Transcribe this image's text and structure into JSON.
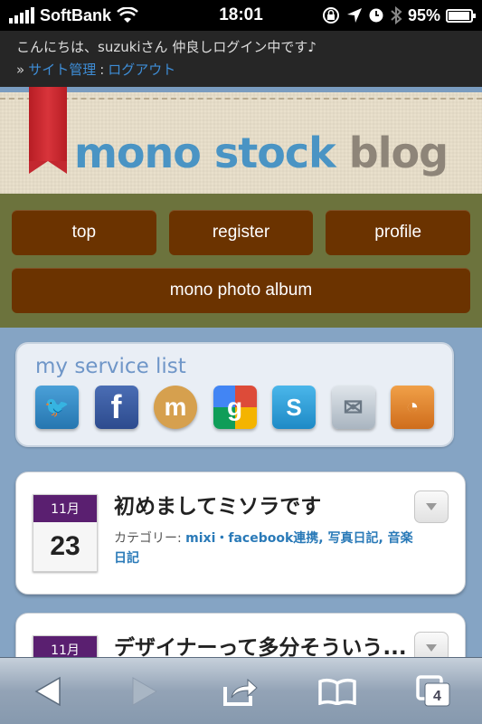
{
  "status_bar": {
    "carrier": "SoftBank",
    "time": "18:01",
    "battery_percent": "95%",
    "battery_level": 0.95
  },
  "admin_bar": {
    "greeting": "こんにちは、suzukiさん 仲良しログイン中です♪",
    "raquo": "»",
    "site_admin_link": "サイト管理",
    "separator": ":",
    "logout_link": "ログアウト"
  },
  "header": {
    "title_part1": "mono",
    "title_part2": "stock",
    "title_part3": "blog"
  },
  "nav": {
    "items": [
      {
        "label": "top"
      },
      {
        "label": "register"
      },
      {
        "label": "profile"
      },
      {
        "label": "mono photo album"
      }
    ]
  },
  "services": {
    "title": "my service list",
    "items": [
      {
        "icon": "twitter-icon",
        "glyph": "🐦"
      },
      {
        "icon": "facebook-icon",
        "glyph": "f"
      },
      {
        "icon": "mixi-icon",
        "glyph": "m"
      },
      {
        "icon": "google-icon",
        "glyph": "g"
      },
      {
        "icon": "skype-icon",
        "glyph": "S"
      },
      {
        "icon": "mail-icon",
        "glyph": "✉"
      },
      {
        "icon": "rss-icon",
        "glyph": "◔"
      }
    ]
  },
  "posts": [
    {
      "month": "11月",
      "day": "23",
      "title": "初めましてミソラです",
      "category_label": "カテゴリー:",
      "categories": "mixi・facebook連携, 写真日記, 音楽日記"
    },
    {
      "month": "11月",
      "title": "デザイナーって多分そういう..."
    }
  ],
  "toolbar": {
    "tabs_count": "4"
  }
}
